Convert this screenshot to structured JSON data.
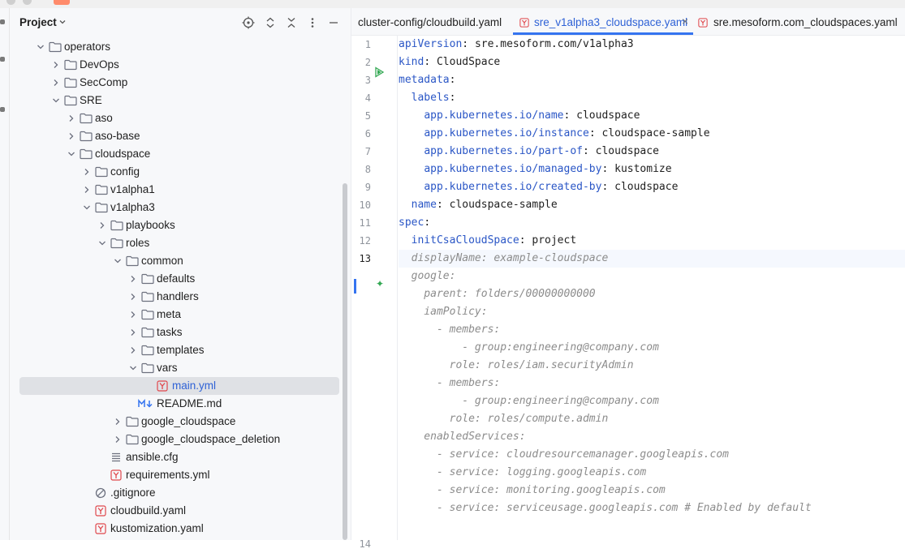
{
  "panel": {
    "title": "Project",
    "icons": [
      "target-icon",
      "expand-icon",
      "collapse-icon",
      "more-icon",
      "minimize-icon"
    ]
  },
  "tree": [
    {
      "label": "operators",
      "type": "folder",
      "depth": 1,
      "expanded": true
    },
    {
      "label": "DevOps",
      "type": "folder",
      "depth": 2,
      "expanded": false
    },
    {
      "label": "SecComp",
      "type": "folder",
      "depth": 2,
      "expanded": false
    },
    {
      "label": "SRE",
      "type": "folder",
      "depth": 2,
      "expanded": true
    },
    {
      "label": "aso",
      "type": "folder",
      "depth": 3,
      "expanded": false
    },
    {
      "label": "aso-base",
      "type": "folder",
      "depth": 3,
      "expanded": false
    },
    {
      "label": "cloudspace",
      "type": "folder",
      "depth": 3,
      "expanded": true
    },
    {
      "label": "config",
      "type": "folder",
      "depth": 4,
      "expanded": false
    },
    {
      "label": "v1alpha1",
      "type": "folder",
      "depth": 4,
      "expanded": false
    },
    {
      "label": "v1alpha3",
      "type": "folder",
      "depth": 4,
      "expanded": true
    },
    {
      "label": "playbooks",
      "type": "folder",
      "depth": 5,
      "expanded": false
    },
    {
      "label": "roles",
      "type": "folder",
      "depth": 5,
      "expanded": true
    },
    {
      "label": "common",
      "type": "folder",
      "depth": 6,
      "expanded": true
    },
    {
      "label": "defaults",
      "type": "folder",
      "depth": 7,
      "expanded": false
    },
    {
      "label": "handlers",
      "type": "folder",
      "depth": 7,
      "expanded": false
    },
    {
      "label": "meta",
      "type": "folder",
      "depth": 7,
      "expanded": false
    },
    {
      "label": "tasks",
      "type": "folder",
      "depth": 7,
      "expanded": false
    },
    {
      "label": "templates",
      "type": "folder",
      "depth": 7,
      "expanded": false
    },
    {
      "label": "vars",
      "type": "folder",
      "depth": 7,
      "expanded": true
    },
    {
      "label": "main.yml",
      "type": "yaml",
      "depth": 8,
      "selected": true
    },
    {
      "label": "README.md",
      "type": "md",
      "depth": 7
    },
    {
      "label": "google_cloudspace",
      "type": "folder",
      "depth": 6,
      "expanded": false
    },
    {
      "label": "google_cloudspace_deletion",
      "type": "folder",
      "depth": 6,
      "expanded": false
    },
    {
      "label": "ansible.cfg",
      "type": "cfg",
      "depth": 5
    },
    {
      "label": "requirements.yml",
      "type": "yaml",
      "depth": 5
    },
    {
      "label": ".gitignore",
      "type": "ignore",
      "depth": 4
    },
    {
      "label": "cloudbuild.yaml",
      "type": "yaml",
      "depth": 4
    },
    {
      "label": "kustomization.yaml",
      "type": "yaml",
      "depth": 4
    }
  ],
  "tabs": [
    {
      "label": "cluster-config/cloudbuild.yaml",
      "icon": false,
      "active": false
    },
    {
      "label": "sre_v1alpha3_cloudspace.yaml",
      "icon": true,
      "active": true,
      "closable": true
    },
    {
      "label": "sre.mesoform.com_cloudspaces.yaml",
      "icon": true,
      "active": false
    }
  ],
  "editor": {
    "current_line": 13,
    "lines": [
      {
        "n": "1",
        "parts": [
          [
            "k",
            "apiVersion"
          ],
          [
            "p",
            ": "
          ],
          [
            "v",
            "sre.mesoform.com/v1alpha3"
          ]
        ]
      },
      {
        "n": "2",
        "parts": [
          [
            "k",
            "kind"
          ],
          [
            "p",
            ": "
          ],
          [
            "v",
            "CloudSpace"
          ]
        ]
      },
      {
        "n": "3",
        "parts": [
          [
            "k",
            "metadata"
          ],
          [
            "p",
            ":"
          ]
        ]
      },
      {
        "n": "4",
        "parts": [
          [
            "p",
            "  "
          ],
          [
            "k",
            "labels"
          ],
          [
            "p",
            ":"
          ]
        ]
      },
      {
        "n": "5",
        "parts": [
          [
            "p",
            "    "
          ],
          [
            "k",
            "app.kubernetes.io/name"
          ],
          [
            "p",
            ": "
          ],
          [
            "v",
            "cloudspace"
          ]
        ]
      },
      {
        "n": "6",
        "parts": [
          [
            "p",
            "    "
          ],
          [
            "k",
            "app.kubernetes.io/instance"
          ],
          [
            "p",
            ": "
          ],
          [
            "v",
            "cloudspace-sample"
          ]
        ]
      },
      {
        "n": "7",
        "parts": [
          [
            "p",
            "    "
          ],
          [
            "k",
            "app.kubernetes.io/part-of"
          ],
          [
            "p",
            ": "
          ],
          [
            "v",
            "cloudspace"
          ]
        ]
      },
      {
        "n": "8",
        "parts": [
          [
            "p",
            "    "
          ],
          [
            "k",
            "app.kubernetes.io/managed-by"
          ],
          [
            "p",
            ": "
          ],
          [
            "v",
            "kustomize"
          ]
        ]
      },
      {
        "n": "9",
        "parts": [
          [
            "p",
            "    "
          ],
          [
            "k",
            "app.kubernetes.io/created-by"
          ],
          [
            "p",
            ": "
          ],
          [
            "v",
            "cloudspace"
          ]
        ]
      },
      {
        "n": "10",
        "parts": [
          [
            "p",
            "  "
          ],
          [
            "k",
            "name"
          ],
          [
            "p",
            ": "
          ],
          [
            "v",
            "cloudspace-sample"
          ]
        ]
      },
      {
        "n": "11",
        "parts": [
          [
            "k",
            "spec"
          ],
          [
            "p",
            ":"
          ]
        ]
      },
      {
        "n": "12",
        "parts": [
          [
            "p",
            "  "
          ],
          [
            "k",
            "initCsaCloudSpace"
          ],
          [
            "p",
            ": "
          ],
          [
            "v",
            "project"
          ]
        ]
      },
      {
        "n": "13",
        "parts": [
          [
            "c",
            "  displayName: example-cloudspace"
          ]
        ]
      },
      {
        "n": "",
        "parts": [
          [
            "c",
            "  google:"
          ]
        ]
      },
      {
        "n": "",
        "parts": [
          [
            "c",
            "    parent: folders/00000000000"
          ]
        ]
      },
      {
        "n": "",
        "parts": [
          [
            "c",
            "    iamPolicy:"
          ]
        ]
      },
      {
        "n": "",
        "parts": [
          [
            "c",
            "      - members:"
          ]
        ]
      },
      {
        "n": "",
        "parts": [
          [
            "c",
            "          - group:engineering@company.com"
          ]
        ]
      },
      {
        "n": "",
        "parts": [
          [
            "c",
            "        role: roles/iam.securityAdmin"
          ]
        ]
      },
      {
        "n": "",
        "parts": [
          [
            "c",
            "      - members:"
          ]
        ]
      },
      {
        "n": "",
        "parts": [
          [
            "c",
            "          - group:engineering@company.com"
          ]
        ]
      },
      {
        "n": "",
        "parts": [
          [
            "c",
            "        role: roles/compute.admin"
          ]
        ]
      },
      {
        "n": "",
        "parts": [
          [
            "c",
            "    enabledServices:"
          ]
        ]
      },
      {
        "n": "",
        "parts": [
          [
            "c",
            "      - service: cloudresourcemanager.googleapis.com"
          ]
        ]
      },
      {
        "n": "",
        "parts": [
          [
            "c",
            "      - service: logging.googleapis.com"
          ]
        ]
      },
      {
        "n": "",
        "parts": [
          [
            "c",
            "      - service: monitoring.googleapis.com"
          ]
        ]
      },
      {
        "n": "",
        "parts": [
          [
            "c",
            "      - service: serviceusage.googleapis.com # Enabled by default"
          ]
        ]
      },
      {
        "n": "",
        "parts": []
      },
      {
        "n": "14",
        "parts": []
      }
    ]
  },
  "colors": {
    "accent": "#3574f0",
    "key": "#2a56c6",
    "comment": "#8c8c8c",
    "yaml_icon": "#e0474c",
    "md_icon": "#3574f0"
  }
}
